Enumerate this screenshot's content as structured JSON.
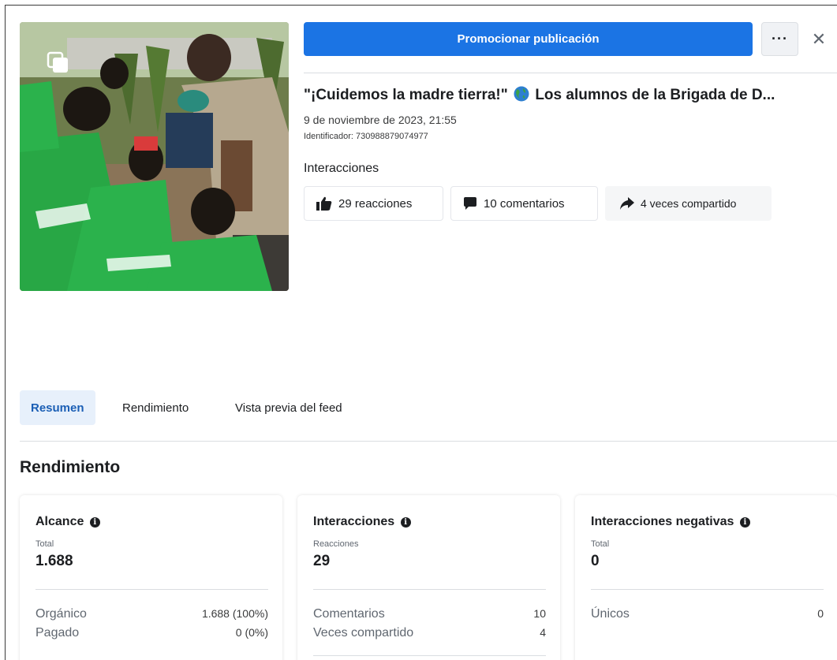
{
  "header": {
    "promote_label": "Promocionar publicación",
    "more_label": "···",
    "close_label": "✕"
  },
  "post": {
    "title_prefix": "\"¡Cuidemos la madre tierra!\"",
    "title_suffix": "Los alumnos de la Brigada de D...",
    "date": "9 de noviembre de 2023, 21:55",
    "id": "Identificador: 730988879074977",
    "interactions_label": "Interacciones",
    "reactions": "29 reacciones",
    "comments": "10 comentarios",
    "shares": "4 veces compartido"
  },
  "tabs": [
    {
      "label": "Resumen",
      "active": true
    },
    {
      "label": "Rendimiento",
      "active": false
    },
    {
      "label": "Vista previa del feed",
      "active": false
    }
  ],
  "section_title": "Rendimiento",
  "cards": [
    {
      "title": "Alcance",
      "sub": "Total",
      "big": "1.688",
      "rows": [
        {
          "label": "Orgánico",
          "value": "1.688 (100%)"
        },
        {
          "label": "Pagado",
          "value": "0 (0%)"
        }
      ]
    },
    {
      "title": "Interacciones",
      "sub": "Reacciones",
      "big": "29",
      "rows": [
        {
          "label": "Comentarios",
          "value": "10"
        },
        {
          "label": "Veces compartido",
          "value": "4"
        }
      ]
    },
    {
      "title": "Interacciones negativas",
      "sub": "Total",
      "big": "0",
      "rows": [
        {
          "label": "Únicos",
          "value": "0"
        }
      ]
    }
  ],
  "colors": {
    "primary": "#1b74e4",
    "tab_active_bg": "#e7f0fb",
    "tab_active_text": "#1b5fb5"
  },
  "icons": [
    "multiple-photos-icon",
    "globe-icon",
    "thumbs-up-icon",
    "comment-icon",
    "share-icon",
    "info-icon",
    "more-icon",
    "close-icon"
  ]
}
